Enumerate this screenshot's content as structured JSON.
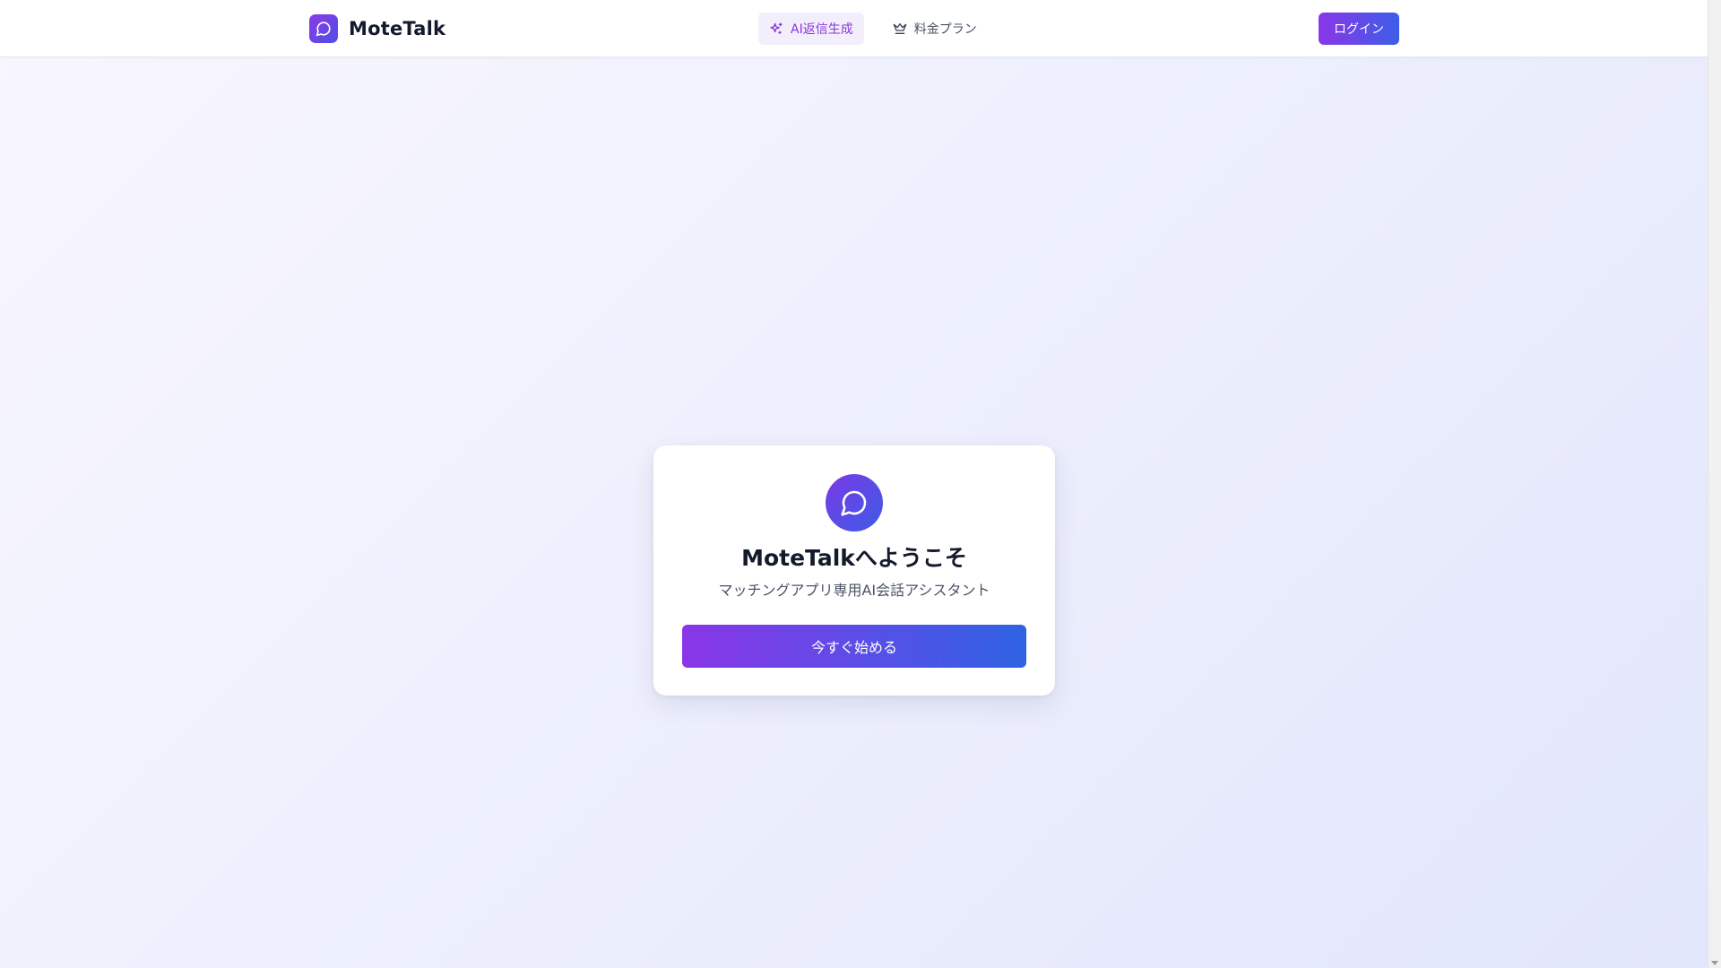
{
  "header": {
    "brand": {
      "name": "MoteTalk",
      "icon": "message-circle-icon"
    },
    "nav": [
      {
        "label": "AI返信生成",
        "icon": "sparkles-icon",
        "active": true
      },
      {
        "label": "料金プラン",
        "icon": "crown-icon",
        "active": false
      }
    ],
    "login_label": "ログイン"
  },
  "card": {
    "icon": "message-circle-icon",
    "title": "MoteTalkへようこそ",
    "subtitle": "マッチングアプリ専用AI会話アシスタント",
    "cta_label": "今すぐ始める"
  },
  "colors": {
    "accent_purple": "#8a36e8",
    "accent_blue": "#2f63e4",
    "active_nav_text": "#8a36d9",
    "active_nav_bg": "#f3eefc",
    "text_dark": "#141a2b",
    "text_muted": "#4a5265"
  }
}
